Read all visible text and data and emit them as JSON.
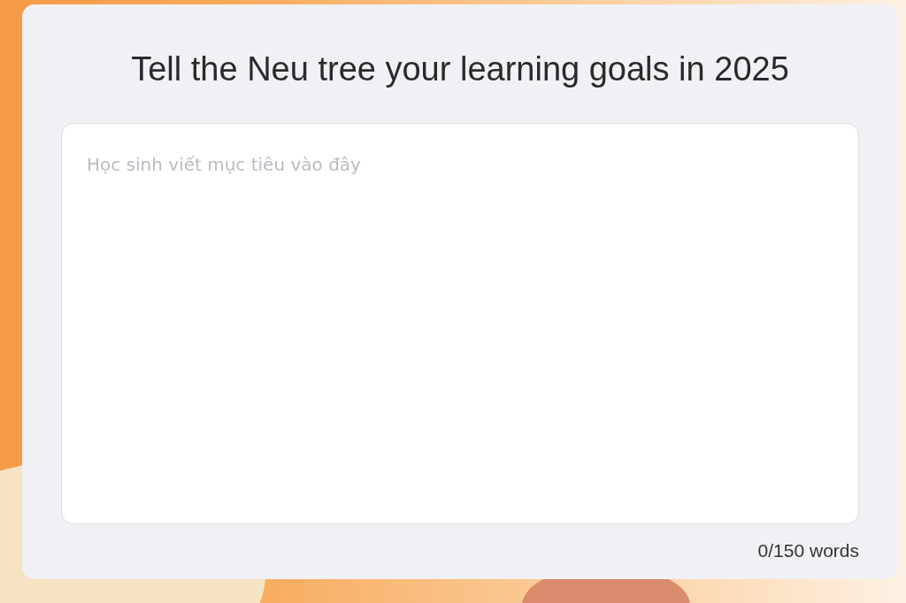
{
  "card": {
    "title": "Tell the Neu tree your learning goals in 2025"
  },
  "goal_field": {
    "placeholder": "Học sinh viết mục tiêu vào đây"
  },
  "word_count": "0/150 words"
}
